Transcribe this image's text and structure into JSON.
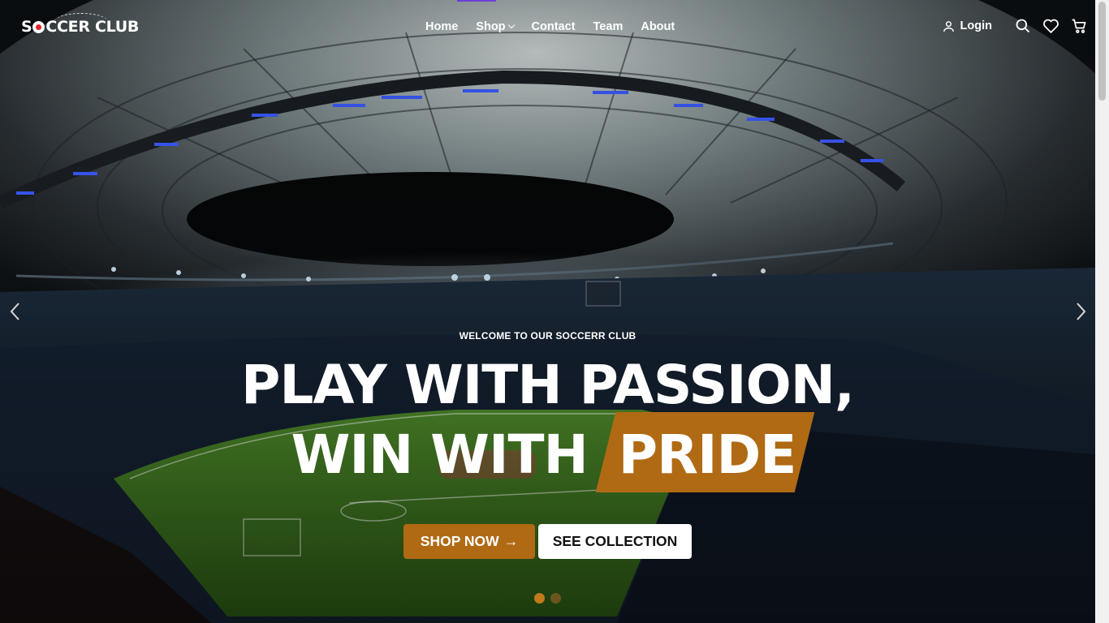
{
  "brand": {
    "name_part1": "S",
    "name_part2": "CCER CLUB"
  },
  "nav": {
    "items": [
      {
        "label": "Home"
      },
      {
        "label": "Shop"
      },
      {
        "label": "Contact"
      },
      {
        "label": "Team"
      },
      {
        "label": "About"
      }
    ]
  },
  "header": {
    "login_label": "Login"
  },
  "hero": {
    "eyebrow": "WELCOME TO OUR SOCCERR CLUB",
    "line1": "PLAY WITH PASSION,",
    "line2_prefix": "WIN WITH",
    "line2_highlight": "PRIDE",
    "primary_button": "SHOP NOW",
    "primary_arrow": "→",
    "secondary_button": "SEE COLLECTION",
    "slides_total": 2,
    "active_slide": 1
  },
  "colors": {
    "accent": "#b06a14",
    "dot_active": "#c27a1a",
    "top_progress": "#6b3fd6"
  },
  "icons": [
    "user-icon",
    "search-icon",
    "heart-icon",
    "cart-icon",
    "chevron-left-icon",
    "chevron-right-icon",
    "chevron-down-icon"
  ]
}
